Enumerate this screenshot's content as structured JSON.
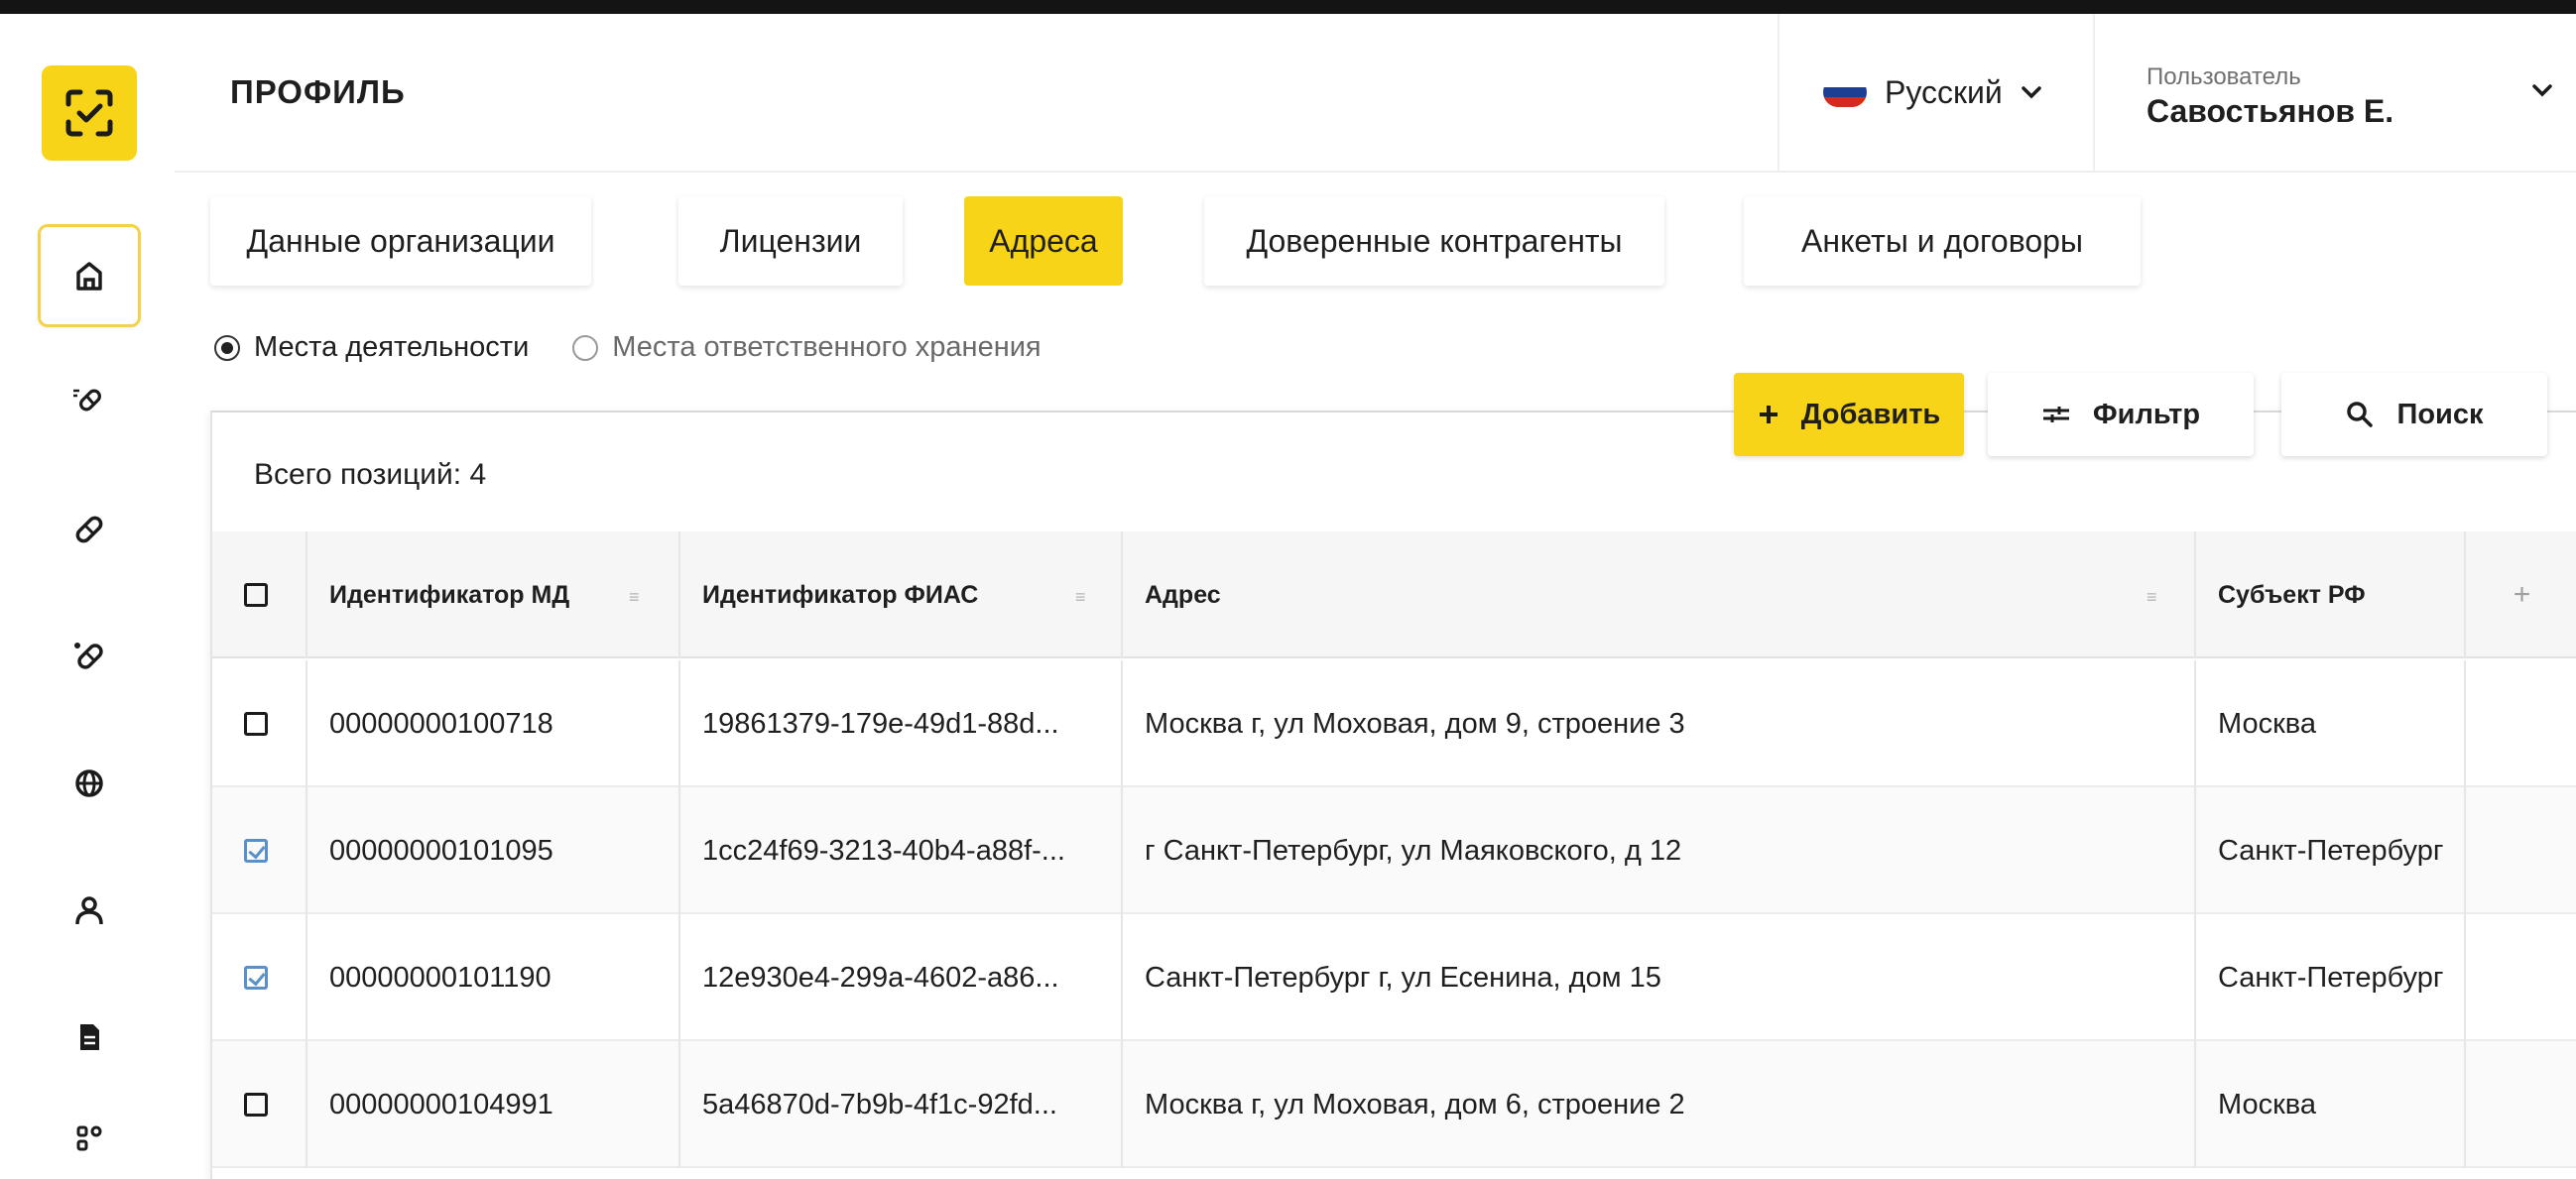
{
  "header": {
    "title": "ПРОФИЛЬ",
    "language": "Русский",
    "user_label": "Пользователь",
    "user_name": "Савостьянов Е."
  },
  "sidebar": {
    "items": [
      {
        "icon": "home-icon",
        "active": true
      },
      {
        "icon": "pills-list-icon",
        "active": false
      },
      {
        "icon": "pill-icon",
        "active": false
      },
      {
        "icon": "pills-icon",
        "active": false
      },
      {
        "icon": "globe-icon",
        "active": false
      },
      {
        "icon": "user-icon",
        "active": false
      },
      {
        "icon": "document-icon",
        "active": false
      },
      {
        "icon": "apps-icon",
        "active": false
      }
    ]
  },
  "tabs": [
    {
      "label": "Данные организации",
      "active": false
    },
    {
      "label": "Лицензии",
      "active": false
    },
    {
      "label": "Адреса",
      "active": true
    },
    {
      "label": "Доверенные контрагенты",
      "active": false
    },
    {
      "label": "Анкеты и договоры",
      "active": false
    }
  ],
  "radios": {
    "option1": "Места деятельности",
    "option2": "Места ответственного хранения",
    "selected": "option1"
  },
  "toolbar": {
    "add_label": "Добавить",
    "filter_label": "Фильтр",
    "search_label": "Поиск"
  },
  "table": {
    "total_text": "Всего позиций: 4",
    "columns": [
      "Идентификатор МД",
      "Идентификатор ФИАС",
      "Адрес",
      "Субъект РФ"
    ],
    "add_column": "+",
    "rows": [
      {
        "checked": false,
        "md": "00000000100718",
        "fias": "19861379-179e-49d1-88d...",
        "address": "Москва г, ул Моховая, дом 9, строение 3",
        "subject": "Москва"
      },
      {
        "checked": true,
        "md": "00000000101095",
        "fias": "1cc24f69-3213-40b4-a88f-...",
        "address": "г Санкт-Петербург, ул Маяковского, д 12",
        "subject": "Санкт-Петербург"
      },
      {
        "checked": true,
        "md": "00000000101190",
        "fias": "12e930e4-299a-4602-a86...",
        "address": "Санкт-Петербург г, ул Есенина, дом 15",
        "subject": "Санкт-Петербург"
      },
      {
        "checked": false,
        "md": "00000000104991",
        "fias": "5a46870d-7b9b-4f1c-92fd...",
        "address": "Москва г, ул Моховая, дом 6, строение 2",
        "subject": "Москва"
      }
    ]
  },
  "colors": {
    "accent": "#f7d417",
    "checkbox_checked": "#5a90c8"
  }
}
